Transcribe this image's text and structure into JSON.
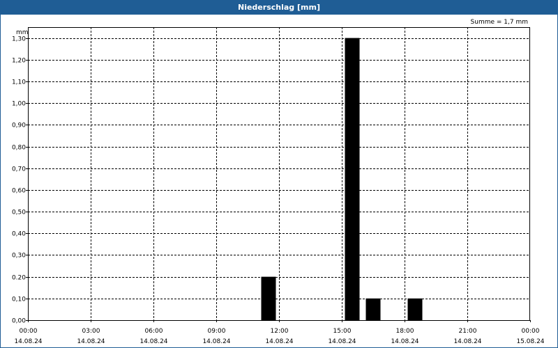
{
  "chart_data": {
    "type": "bar",
    "title": "Niederschlag [mm]",
    "ylabel": "mm",
    "annotation": "Summe = 1,7 mm",
    "ylim": [
      0,
      1.35
    ],
    "yticks": [
      "0,00",
      "0,10",
      "0.20",
      "0,30",
      "0,40",
      "0,50",
      "0,60",
      "0,70",
      "0,80",
      "0,90",
      "1,00",
      "1,10",
      "1,20",
      "1,30"
    ],
    "ytick_values": [
      0,
      0.1,
      0.2,
      0.3,
      0.4,
      0.5,
      0.6,
      0.7,
      0.8,
      0.9,
      1.0,
      1.1,
      1.2,
      1.3
    ],
    "xlim_hours": [
      0,
      24
    ],
    "xticks": [
      {
        "time": "00:00",
        "date": "14.08.24"
      },
      {
        "time": "03:00",
        "date": "14.08.24"
      },
      {
        "time": "06:00",
        "date": "14.08.24"
      },
      {
        "time": "09:00",
        "date": "14.08.24"
      },
      {
        "time": "12:00",
        "date": "14.08.24"
      },
      {
        "time": "15:00",
        "date": "14.08.24"
      },
      {
        "time": "18:00",
        "date": "14.08.24"
      },
      {
        "time": "21:00",
        "date": "14.08.24"
      },
      {
        "time": "00:00",
        "date": "15.08.24"
      }
    ],
    "bars": [
      {
        "start": "11:00",
        "end": "12:00",
        "value": 0.2
      },
      {
        "start": "15:00",
        "end": "16:00",
        "value": 1.3
      },
      {
        "start": "16:00",
        "end": "17:00",
        "value": 0.1
      },
      {
        "start": "18:00",
        "end": "19:00",
        "value": 0.1
      }
    ],
    "grid": true,
    "bar_color": "#000000",
    "title_bar_color": "#1f5d95"
  }
}
